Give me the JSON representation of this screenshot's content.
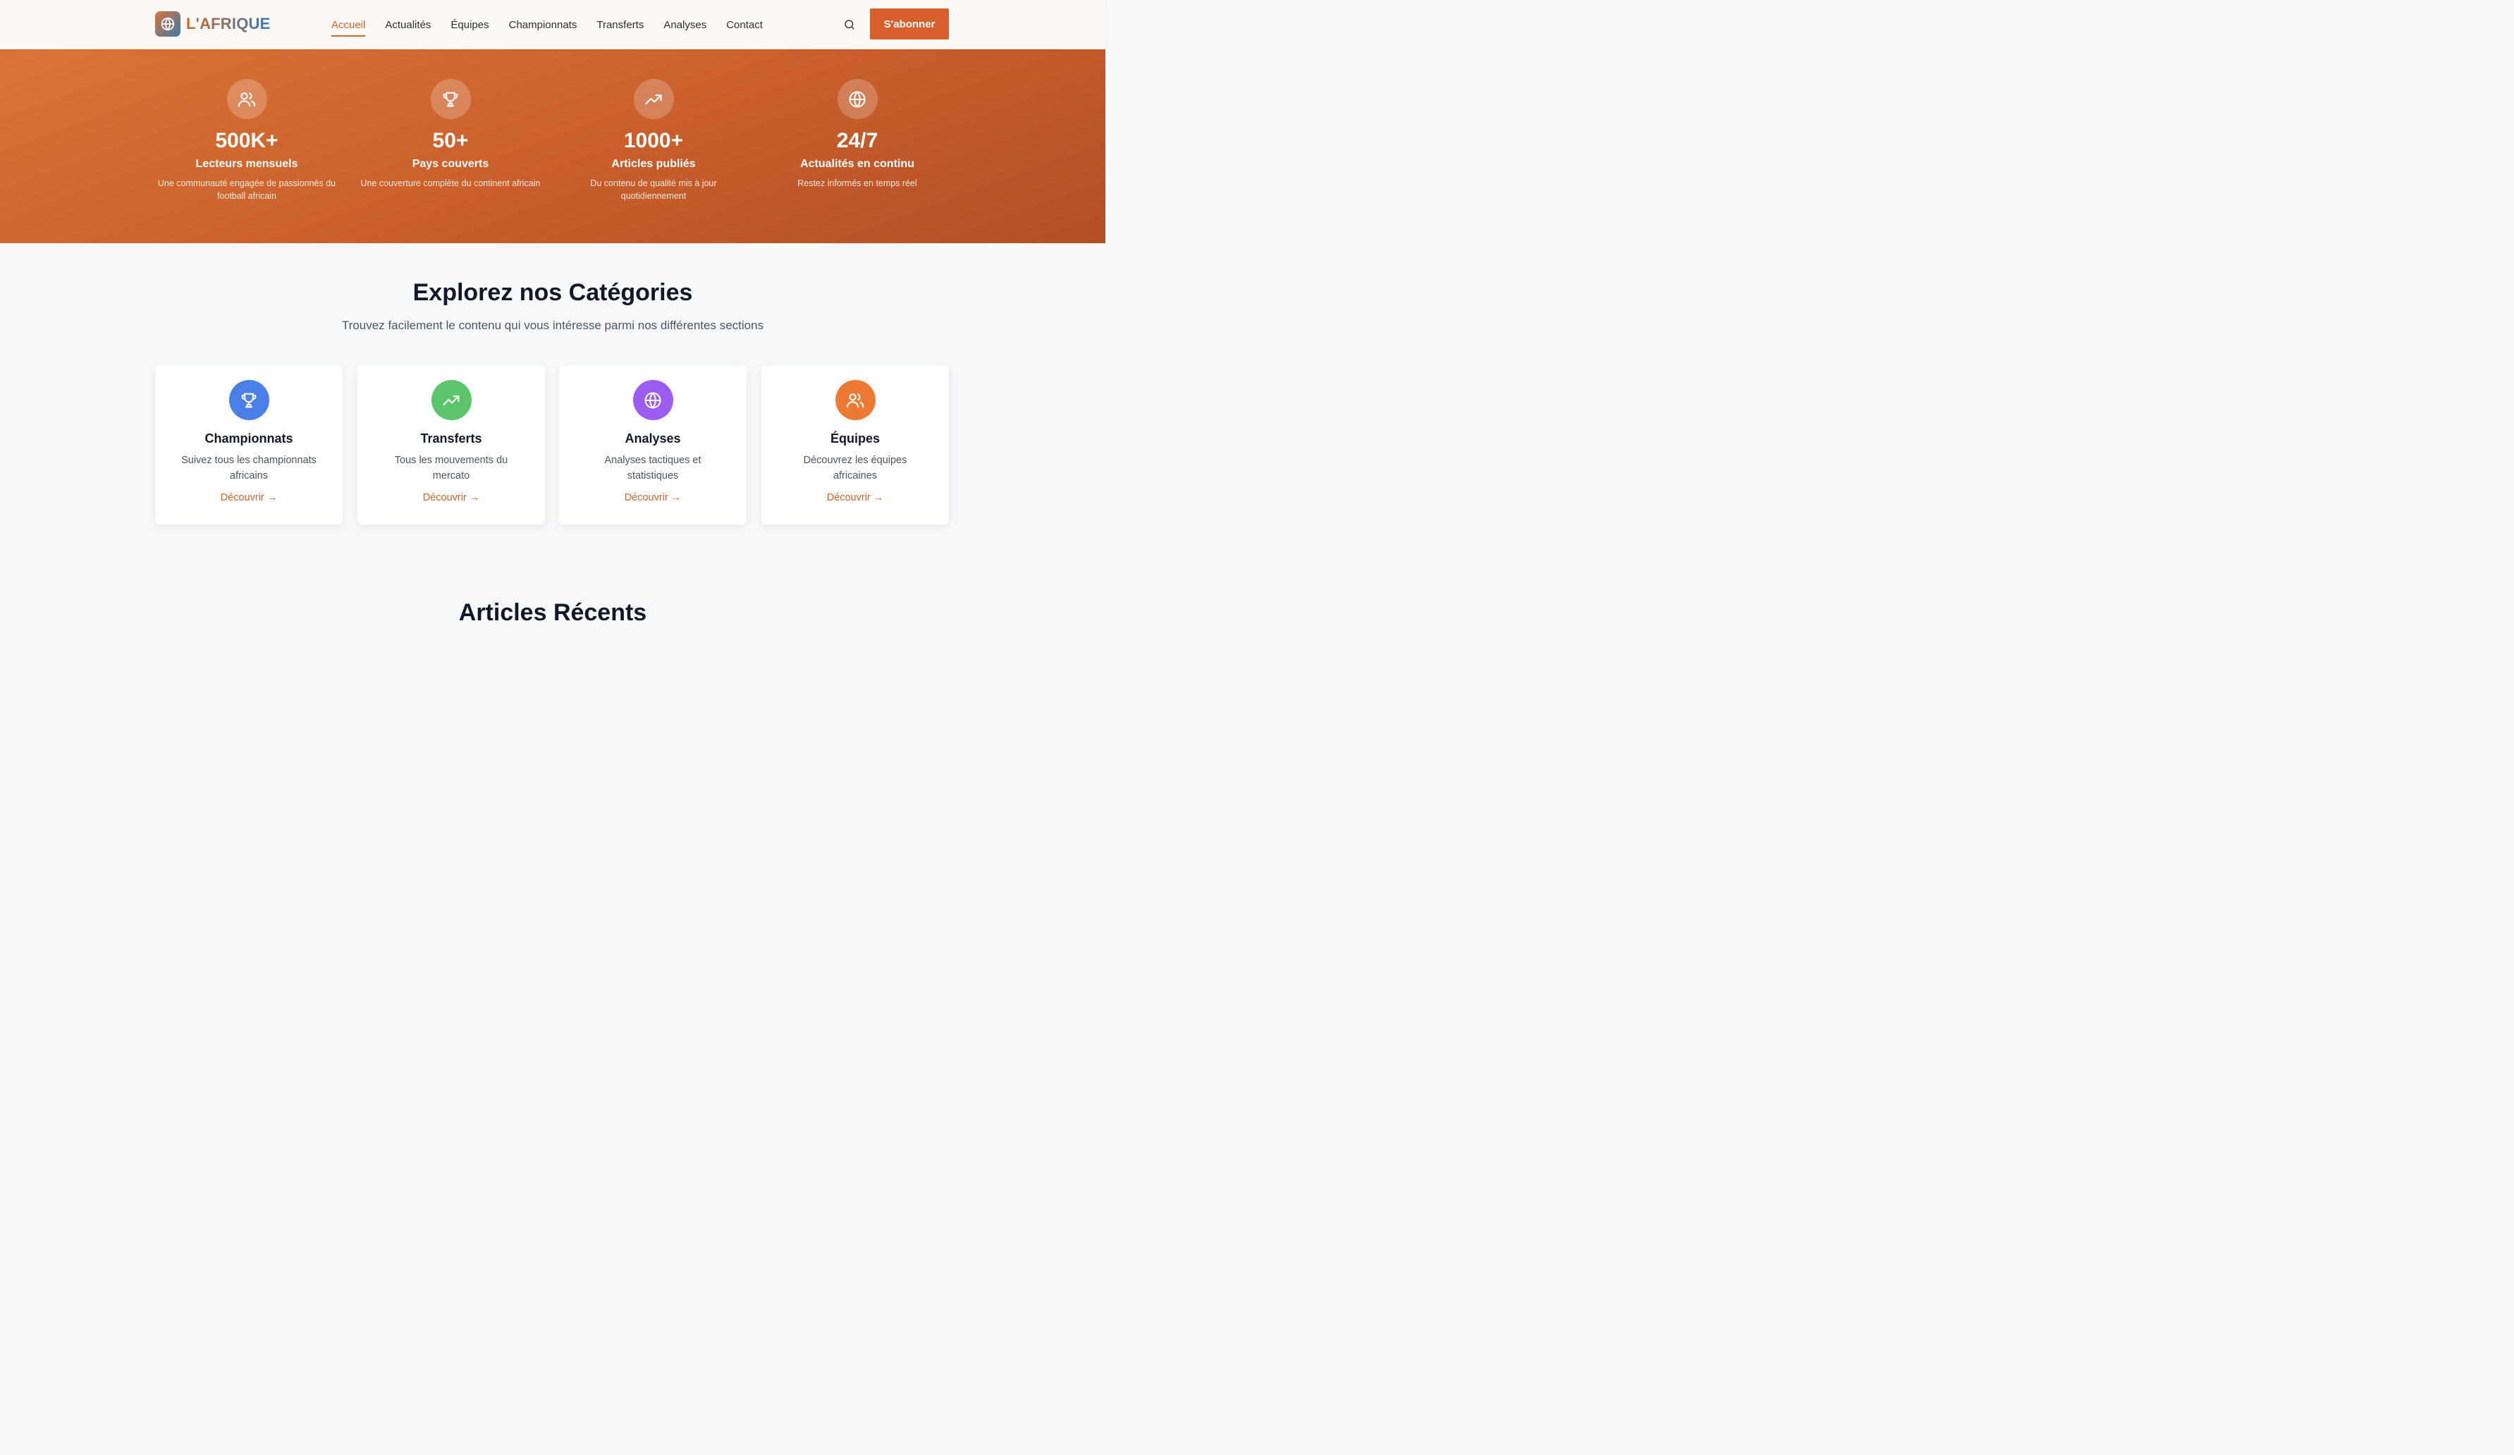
{
  "header": {
    "brand": "L'AFRIQUE",
    "nav": [
      {
        "label": "Accueil",
        "active": true
      },
      {
        "label": "Actualités",
        "active": false
      },
      {
        "label": "Équipes",
        "active": false
      },
      {
        "label": "Championnats",
        "active": false
      },
      {
        "label": "Transferts",
        "active": false
      },
      {
        "label": "Analyses",
        "active": false
      },
      {
        "label": "Contact",
        "active": false
      }
    ],
    "search_icon": "search-icon",
    "subscribe_label": "S'abonner"
  },
  "stats": [
    {
      "icon": "users-icon",
      "value": "500K+",
      "label": "Lecteurs mensuels",
      "desc": "Une communauté engagée de passionnés du football africain"
    },
    {
      "icon": "trophy-icon",
      "value": "50+",
      "label": "Pays couverts",
      "desc": "Une couverture complète du continent africain"
    },
    {
      "icon": "trending-up-icon",
      "value": "1000+",
      "label": "Articles publiés",
      "desc": "Du contenu de qualité mis à jour quotidiennement"
    },
    {
      "icon": "globe-icon",
      "value": "24/7",
      "label": "Actualités en continu",
      "desc": "Restez informés en temps réel"
    }
  ],
  "categories": {
    "title": "Explorez nos Catégories",
    "subtitle": "Trouvez facilement le contenu qui vous intéresse parmi nos différentes sections",
    "items": [
      {
        "icon": "trophy-icon",
        "color": "#4a7fe8",
        "title": "Championnats",
        "desc": "Suivez tous les championnats africains",
        "link": "Découvrir →"
      },
      {
        "icon": "trending-up-icon",
        "color": "#5cc46b",
        "title": "Transferts",
        "desc": "Tous les mouvements du mercato",
        "link": "Découvrir →"
      },
      {
        "icon": "globe-icon",
        "color": "#9b5cf0",
        "title": "Analyses",
        "desc": "Analyses tactiques et statistiques",
        "link": "Découvrir →"
      },
      {
        "icon": "users-icon",
        "color": "#ec7a35",
        "title": "Équipes",
        "desc": "Découvrez les équipes africaines",
        "link": "Découvrir →"
      }
    ]
  },
  "recent": {
    "title": "Articles Récents"
  },
  "colors": {
    "accent": "#d65f2b",
    "hero_start": "#db7436",
    "hero_end": "#b24f25"
  }
}
